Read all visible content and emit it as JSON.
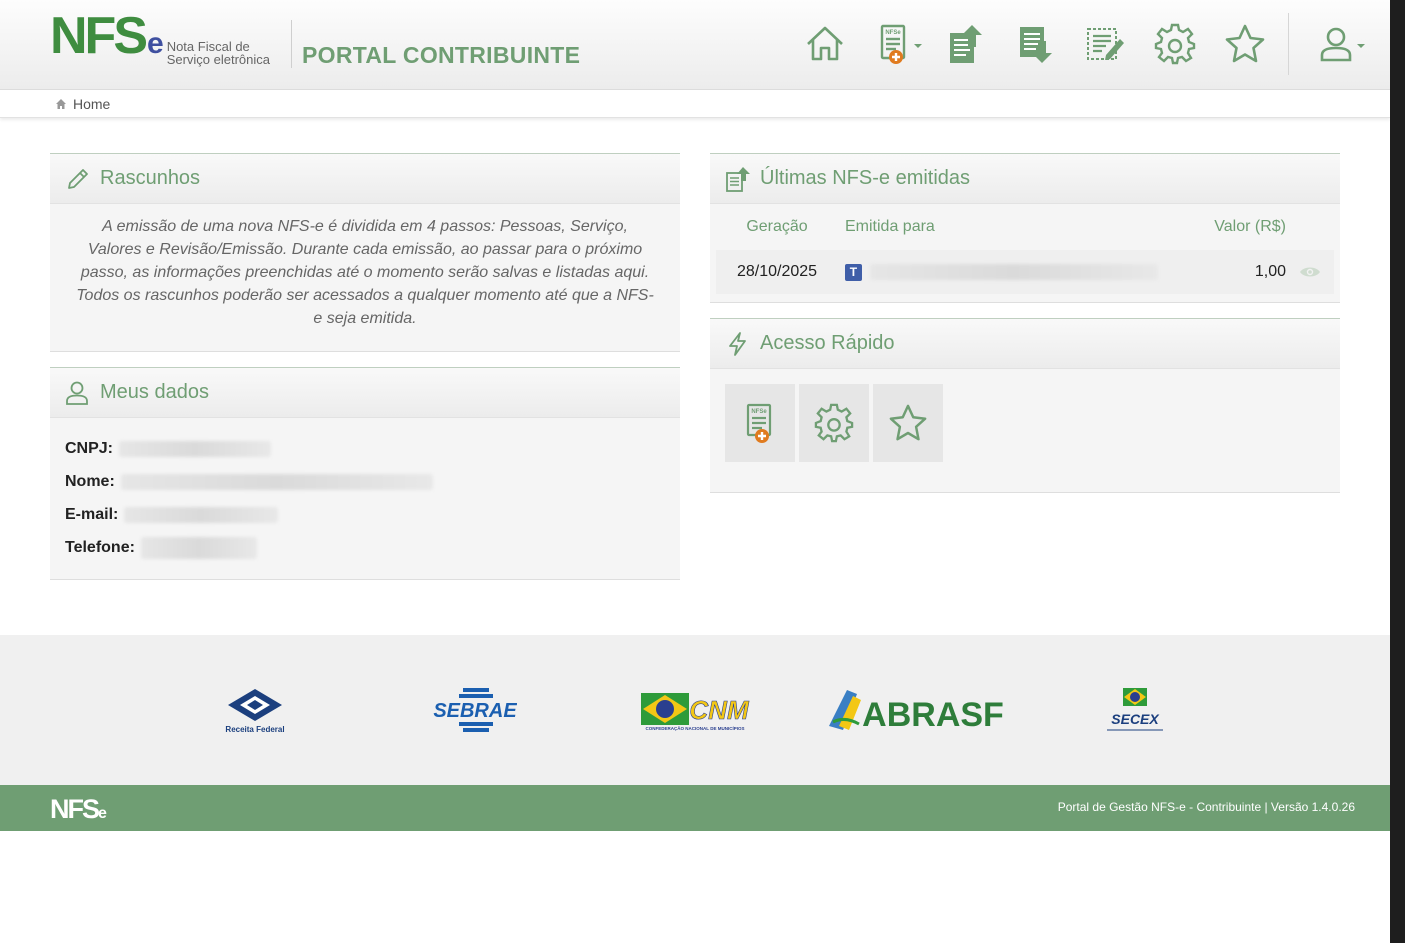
{
  "header": {
    "logo_main": "NFS",
    "logo_e": "e",
    "logo_sub_line1": "Nota Fiscal de",
    "logo_sub_line2": "Serviço eletrônica",
    "portal_title": "PORTAL CONTRIBUINTE",
    "nav_icons": [
      "home-icon",
      "nfse-new-icon",
      "upload-document-icon",
      "download-document-icon",
      "edit-document-icon",
      "gear-icon",
      "star-icon",
      "user-icon"
    ]
  },
  "breadcrumb": {
    "home_label": "Home"
  },
  "rascunhos": {
    "title": "Rascunhos",
    "text": "A emissão de uma nova NFS-e é dividida em 4 passos: Pessoas, Serviço, Valores e Revisão/Emissão. Durante cada emissão, ao passar para o próximo passo, as informações preenchidas até o momento serão salvas e listadas aqui. Todos os rascunhos poderão ser acessados a qualquer momento até que a NFS-e seja emitida."
  },
  "meus_dados": {
    "title": "Meus dados",
    "fields": [
      {
        "label": "CNPJ:"
      },
      {
        "label": "Nome:"
      },
      {
        "label": "E-mail:"
      },
      {
        "label": "Telefone:"
      }
    ]
  },
  "ultimas": {
    "title": "Últimas NFS-e emitidas",
    "columns": {
      "geracao": "Geração",
      "emitida_para": "Emitida para",
      "valor": "Valor (R$)"
    },
    "rows": [
      {
        "geracao": "28/10/2025",
        "badge": "T",
        "valor": "1,00"
      }
    ]
  },
  "acesso_rapido": {
    "title": "Acesso Rápido",
    "items": [
      "nfse-new-icon",
      "gear-icon",
      "star-icon"
    ]
  },
  "partners": {
    "receita": "Receita Federal",
    "sebrae": "SEBRAE",
    "cnm": "CNM",
    "cnm_sub": "CONFEDERAÇÃO NACIONAL DE MUNICÍPIOS",
    "abrasf": "ABRASF",
    "secex": "SECEX"
  },
  "footer": {
    "logo_main": "NFS",
    "logo_e": "e",
    "text": "Portal de Gestão NFS-e - Contribuinte | Versão 1.4.0.26"
  },
  "colors": {
    "accent": "#6f9e73",
    "badge": "#3f5ea8"
  }
}
